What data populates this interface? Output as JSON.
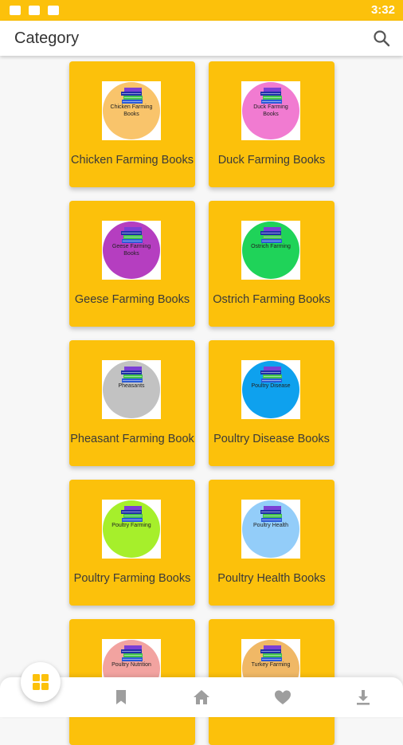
{
  "statusbar": {
    "time": "3:32",
    "icons": [
      "image-icon",
      "folder-icon",
      "store-icon"
    ]
  },
  "appbar": {
    "title": "Category",
    "search_icon": "search-icon"
  },
  "categories": [
    {
      "label": "Chicken Farming Books",
      "thumb_text": "Chicken Farming Books",
      "color": "#f9c46b"
    },
    {
      "label": "Duck Farming Books",
      "thumb_text": "Duck Farming Books",
      "color": "#f17bd1"
    },
    {
      "label": "Geese Farming Books",
      "thumb_text": "Geese Farming Books",
      "color": "#b53ec0"
    },
    {
      "label": "Ostrich Farming Books",
      "thumb_text": "Ostrich Farming",
      "color": "#1fd359"
    },
    {
      "label": "Pheasant Farming Book",
      "thumb_text": "Pheasants",
      "color": "#c2c2c2"
    },
    {
      "label": "Poultry Disease Books",
      "thumb_text": "Poultry Disease",
      "color": "#0ea1ee"
    },
    {
      "label": "Poultry Farming Books",
      "thumb_text": "Poultry Farming",
      "color": "#a6ef2b"
    },
    {
      "label": "Poultry Health Books",
      "thumb_text": "Poultry Health",
      "color": "#93cdf9"
    },
    {
      "label": "",
      "thumb_text": "Poultry Nutrition",
      "color": "#f2a3a0"
    },
    {
      "label": "",
      "thumb_text": "Turkey Farming",
      "color": "#f0b866"
    }
  ],
  "bottomnav": {
    "fab_icon": "grid-icon",
    "items": [
      "bookmark-icon",
      "home-icon",
      "heart-icon",
      "download-icon"
    ],
    "accent": "#fcc10b",
    "inactive": "#9e9e9e"
  }
}
